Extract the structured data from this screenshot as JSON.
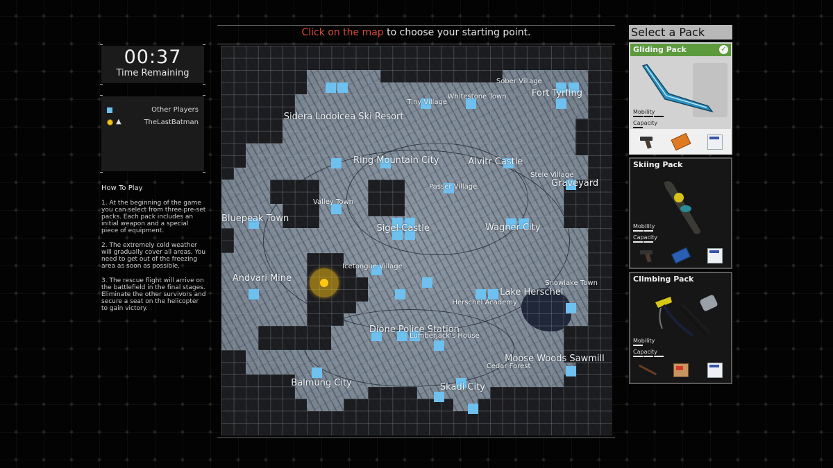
{
  "timer": {
    "value": "00:37",
    "label": "Time Remaining"
  },
  "legend": {
    "items": [
      {
        "icon": "square-marker-icon",
        "label": "Other Players",
        "color": "#6ec0ef"
      },
      {
        "icon": "player-dot-icon",
        "secondary_icon": "glider-icon",
        "label": "TheLastBatman",
        "color": "#f4c21a"
      }
    ]
  },
  "how_to_play": {
    "title": "How To Play",
    "steps": [
      "1. At the beginning of the game you can select from three pre-set packs. Each pack includes an initial weapon and a special piece of equipment.",
      "2. The extremely cold weather will gradually cover all areas. You need to get out of the freezing area as soon as possible.",
      "3. The rescue flight will arrive on the battlefield in the final stages. Eliminate the other survivors and secure a seat on the helicopter to gain victory."
    ]
  },
  "instruction": {
    "highlight": "Click on the map",
    "rest": " to choose your starting point.",
    "highlight_color": "#d34a3b"
  },
  "map": {
    "grid": {
      "cols": 32,
      "rows": 32
    },
    "places": [
      {
        "name": "Sidera Lodoicea Ski Resort",
        "size": "big",
        "col": 5.1,
        "row": 5.4
      },
      {
        "name": "Tiny Village",
        "size": "small",
        "col": 15.2,
        "row": 4.3
      },
      {
        "name": "Whitestone Town",
        "size": "small",
        "col": 18.5,
        "row": 3.9
      },
      {
        "name": "Sober Village",
        "size": "small",
        "col": 22.5,
        "row": 2.6
      },
      {
        "name": "Fort Tyrfing",
        "size": "big",
        "col": 25.4,
        "row": 3.5
      },
      {
        "name": "Ring Mountain City",
        "size": "big",
        "col": 10.8,
        "row": 9.0
      },
      {
        "name": "Alvitr Castle",
        "size": "big",
        "col": 20.2,
        "row": 9.1
      },
      {
        "name": "Stele Village",
        "size": "small",
        "col": 25.3,
        "row": 10.3
      },
      {
        "name": "Graveyard",
        "size": "big",
        "col": 27.0,
        "row": 10.9
      },
      {
        "name": "Passer Village",
        "size": "small",
        "col": 17.0,
        "row": 11.3
      },
      {
        "name": "Valley Town",
        "size": "small",
        "col": 7.5,
        "row": 12.5
      },
      {
        "name": "Bluepeak Town",
        "size": "big",
        "col": 0.0,
        "row": 13.8
      },
      {
        "name": "Sigel Castle",
        "size": "big",
        "col": 12.7,
        "row": 14.6
      },
      {
        "name": "Wagner City",
        "size": "big",
        "col": 21.6,
        "row": 14.5
      },
      {
        "name": "Icetongue Village",
        "size": "small",
        "col": 9.9,
        "row": 17.8
      },
      {
        "name": "Andvari Mine",
        "size": "big",
        "col": 0.9,
        "row": 18.7
      },
      {
        "name": "Snowlake Town",
        "size": "small",
        "col": 26.5,
        "row": 19.2
      },
      {
        "name": "Lake Herschel",
        "size": "big",
        "col": 22.8,
        "row": 19.8
      },
      {
        "name": "Herschel Academy",
        "size": "small",
        "col": 18.9,
        "row": 20.8
      },
      {
        "name": "Dione Police Station",
        "size": "big",
        "col": 12.1,
        "row": 22.9
      },
      {
        "name": "Lumberjack's House",
        "size": "small",
        "col": 15.4,
        "row": 23.5
      },
      {
        "name": "Moose Woods Sawmill",
        "size": "big",
        "col": 23.2,
        "row": 25.3
      },
      {
        "name": "Cedar Forest",
        "size": "small",
        "col": 21.7,
        "row": 26.0
      },
      {
        "name": "Balmung City",
        "size": "big",
        "col": 5.7,
        "row": 27.3
      },
      {
        "name": "Skadi City",
        "size": "big",
        "col": 17.9,
        "row": 27.6
      }
    ],
    "other_players": [
      [
        8.5,
        3
      ],
      [
        9.5,
        3
      ],
      [
        16.3,
        4.3
      ],
      [
        20,
        4.3
      ],
      [
        27.4,
        3
      ],
      [
        28.4,
        3
      ],
      [
        27.4,
        4.3
      ],
      [
        9,
        9.2
      ],
      [
        13,
        9.2
      ],
      [
        23.1,
        9.2
      ],
      [
        18.2,
        11.3
      ],
      [
        28.2,
        11
      ],
      [
        9,
        13
      ],
      [
        2.2,
        14.2
      ],
      [
        14,
        14.1
      ],
      [
        15,
        14.1
      ],
      [
        14,
        15.1
      ],
      [
        15,
        15.1
      ],
      [
        23.3,
        14.2
      ],
      [
        24.3,
        14.2
      ],
      [
        12.3,
        18
      ],
      [
        16.4,
        19
      ],
      [
        2.2,
        20
      ],
      [
        14.2,
        20
      ],
      [
        20.8,
        20
      ],
      [
        21.8,
        20
      ],
      [
        28.2,
        21.1
      ],
      [
        12.3,
        23.4
      ],
      [
        14.4,
        23.4
      ],
      [
        15.4,
        23.4
      ],
      [
        17.4,
        24.2
      ],
      [
        7.4,
        26.4
      ],
      [
        28.2,
        26.3
      ],
      [
        19.2,
        27.3
      ],
      [
        17.4,
        28.4
      ],
      [
        20.2,
        29.4
      ]
    ],
    "player": {
      "name": "TheLastBatman",
      "col": 8.4,
      "row": 19.5
    }
  },
  "packs": {
    "title": "Select a Pack",
    "list": [
      {
        "name": "Gliding Pack",
        "selected": true,
        "equipment": "glider",
        "mobility": 3,
        "capacity": 1,
        "max": 3,
        "items": [
          "pistol",
          "ammo-box-orange",
          "food-ration"
        ],
        "stat_labels": [
          "Mobility",
          "Capacity"
        ]
      },
      {
        "name": "Skiing Pack",
        "selected": false,
        "equipment": "snowboard",
        "mobility": 2,
        "capacity": 2,
        "max": 3,
        "items": [
          "pistol",
          "ammo-box-blue",
          "food-ration"
        ],
        "stat_labels": [
          "Mobility",
          "Capacity"
        ]
      },
      {
        "name": "Climbing Pack",
        "selected": false,
        "equipment": "ice-axe-and-climbing-gear",
        "mobility": 1,
        "capacity": 3,
        "max": 3,
        "items": [
          "rifle",
          "ammo-crate",
          "food-ration"
        ],
        "stat_labels": [
          "Mobility",
          "Capacity"
        ]
      }
    ]
  }
}
